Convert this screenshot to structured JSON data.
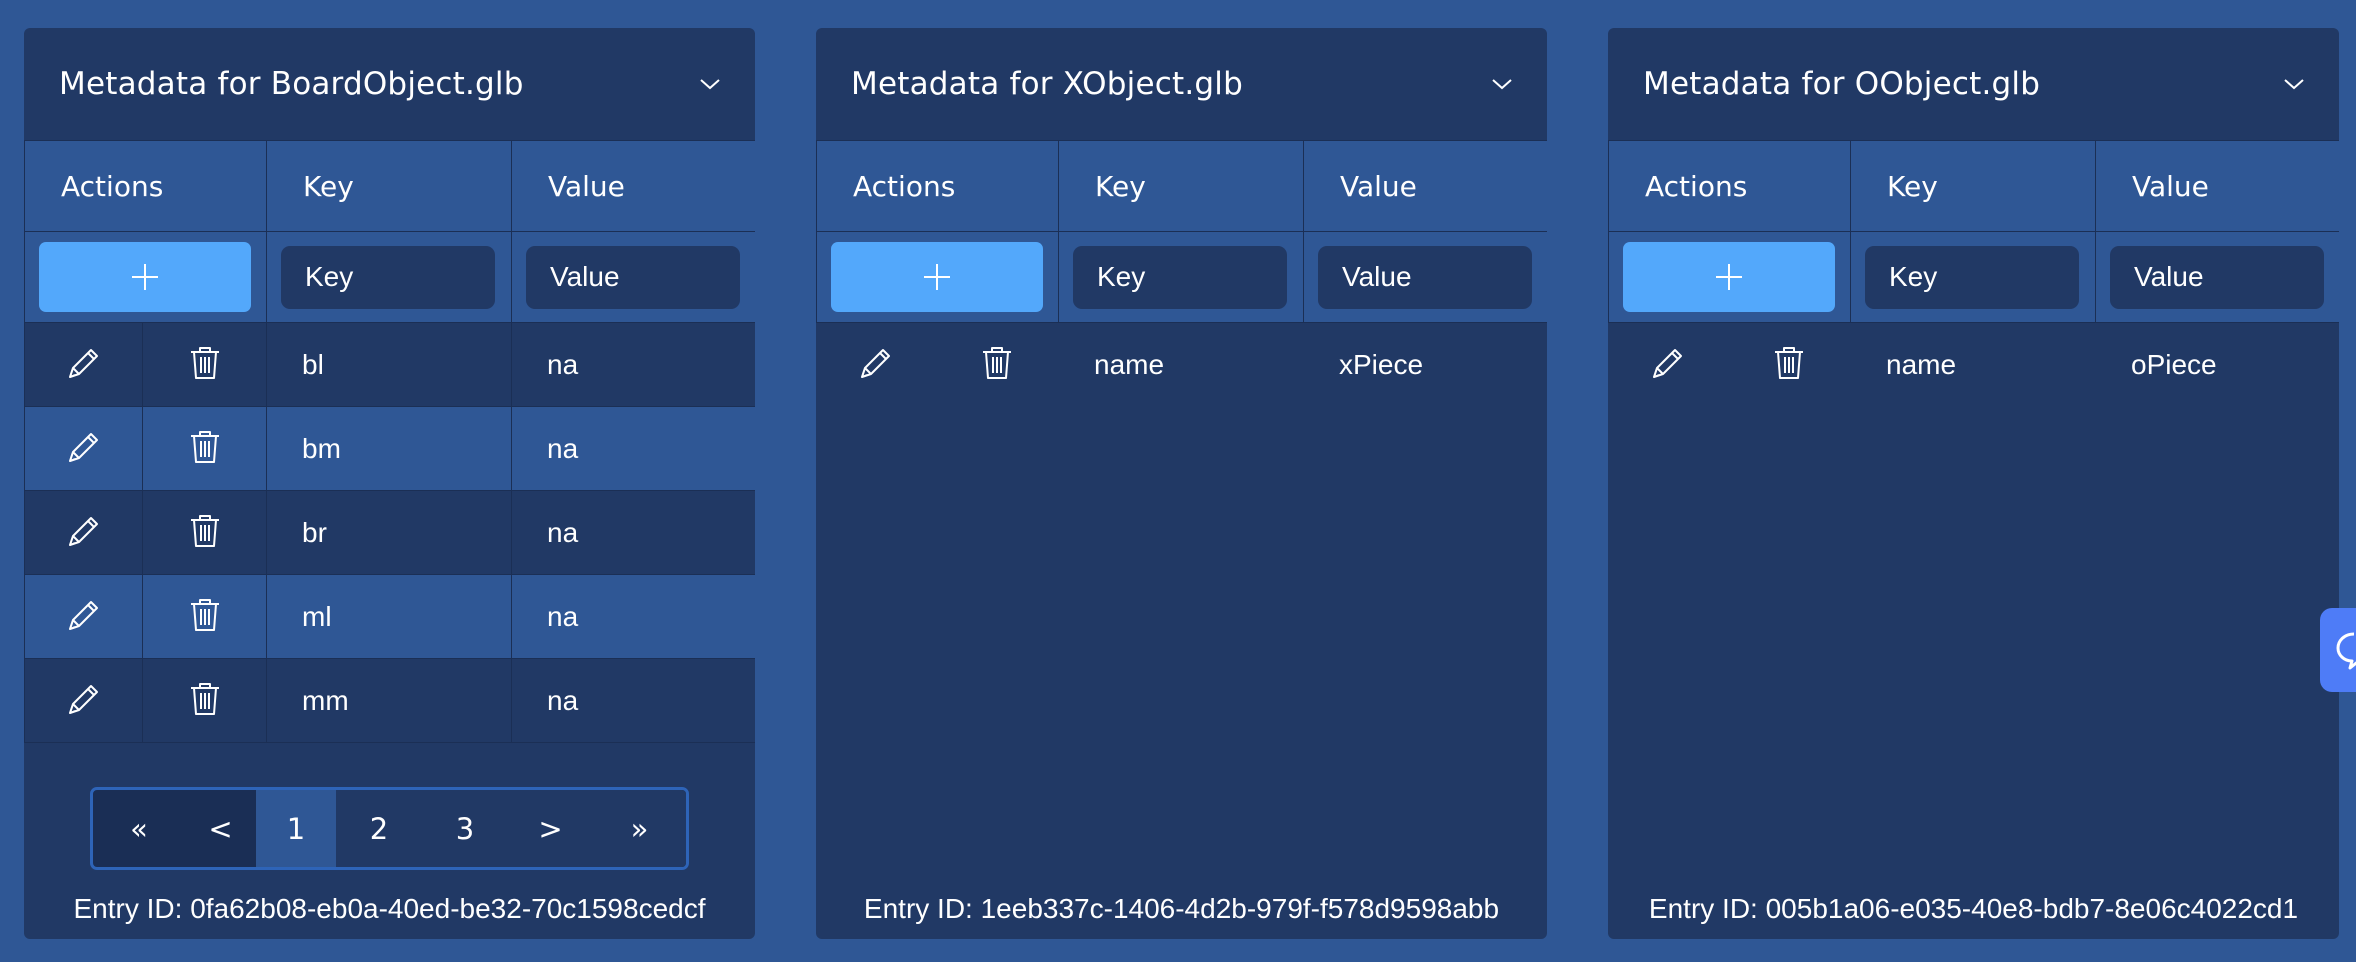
{
  "columns": {
    "actions": "Actions",
    "key": "Key",
    "value": "Value"
  },
  "inputs": {
    "key_placeholder": "Key",
    "value_placeholder": "Value"
  },
  "colors": {
    "page_bg": "#2f5795",
    "panel_bg": "#213965",
    "accent_button": "#53a8fb",
    "pager_border": "#2e64b8",
    "chat_button": "#4e7cf7"
  },
  "icons": {
    "collapse": "chevron-down-icon",
    "add": "plus-icon",
    "edit": "pencil-icon",
    "delete": "trash-icon",
    "chat": "chat-bubble-icon"
  },
  "panels": [
    {
      "title": "Metadata for BoardObject.glb",
      "rows": [
        {
          "key": "bl",
          "value": "na"
        },
        {
          "key": "bm",
          "value": "na"
        },
        {
          "key": "br",
          "value": "na"
        },
        {
          "key": "ml",
          "value": "na"
        },
        {
          "key": "mm",
          "value": "na"
        }
      ],
      "pagination": {
        "first": "«",
        "prev": "<",
        "pages": [
          "1",
          "2",
          "3"
        ],
        "current": "1",
        "next": ">",
        "last": "»"
      },
      "entry_id": "Entry ID: 0fa62b08-eb0a-40ed-be32-70c1598cedcf"
    },
    {
      "title": "Metadata for XObject.glb",
      "rows": [
        {
          "key": "name",
          "value": "xPiece"
        }
      ],
      "entry_id": "Entry ID: 1eeb337c-1406-4d2b-979f-f578d9598abb"
    },
    {
      "title": "Metadata for OObject.glb",
      "rows": [
        {
          "key": "name",
          "value": "oPiece"
        }
      ],
      "entry_id": "Entry ID: 005b1a06-e035-40e8-bdb7-8e06c4022cd1"
    }
  ]
}
